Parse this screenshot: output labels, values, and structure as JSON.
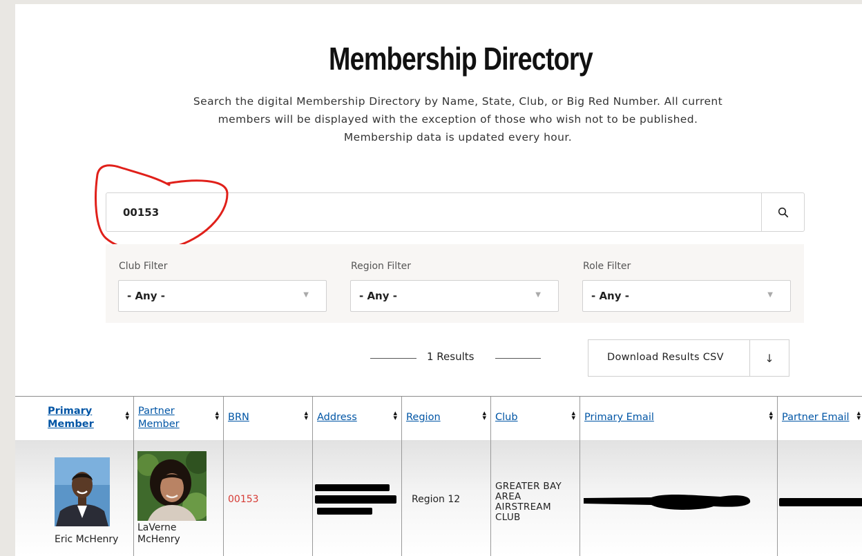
{
  "heading": "Membership Directory",
  "description": "Search the digital Membership Directory by Name, State, Club, or Big Red Number. All current members will be displayed with the exception of those who wish not to be published. Membership data is updated every hour.",
  "search": {
    "value": "00153",
    "icon": "search-icon"
  },
  "filters": [
    {
      "label": "Club Filter",
      "value": "- Any -"
    },
    {
      "label": "Region Filter",
      "value": "- Any -"
    },
    {
      "label": "Role Filter",
      "value": "- Any -"
    }
  ],
  "results": {
    "count_text": "1 Results",
    "download_label": "Download Results CSV",
    "download_icon": "down-arrow-icon"
  },
  "table": {
    "columns": [
      {
        "label": "Primary Member"
      },
      {
        "label": "Partner Member"
      },
      {
        "label": "BRN"
      },
      {
        "label": "Address"
      },
      {
        "label": "Region"
      },
      {
        "label": "Club"
      },
      {
        "label": "Primary Email"
      },
      {
        "label": "Partner Email"
      }
    ],
    "rows": [
      {
        "primary_member": "Eric McHenry",
        "partner_member": "LaVerne McHenry",
        "brn": "00153",
        "address": "[redacted]",
        "region": "Region 12",
        "club": "GREATER BAY AREA AIRSTREAM CLUB",
        "primary_email": "[redacted]",
        "partner_email": "[redacted]"
      }
    ]
  },
  "colors": {
    "link": "#0055a5",
    "brn": "#d63a34",
    "annotation": "#e0201a",
    "filter_panel": "#f8f6f4"
  }
}
